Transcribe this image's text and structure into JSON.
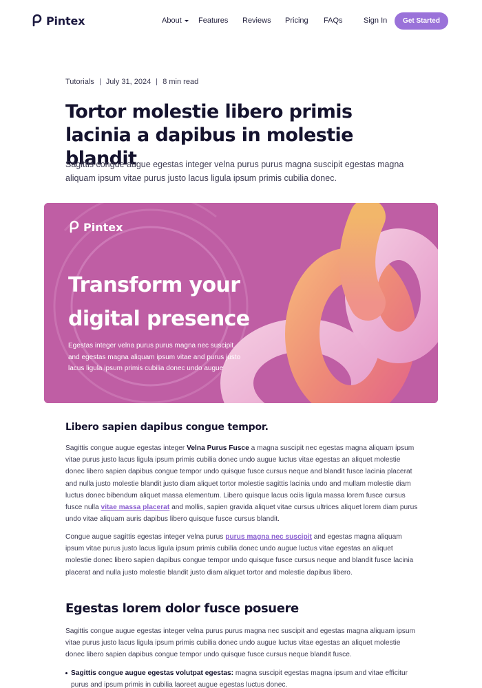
{
  "header": {
    "logo": "Pintex",
    "nav": [
      {
        "label": "About",
        "has_dropdown": true
      },
      {
        "label": "Features"
      },
      {
        "label": "Reviews"
      },
      {
        "label": "Pricing"
      },
      {
        "label": "FAQs"
      }
    ],
    "sign_in": "Sign In",
    "cta": "Get Started"
  },
  "post": {
    "category": "Tutorials",
    "date": "July 31, 2024",
    "read_time": "8 min read",
    "title": "Tortor molestie libero primis lacinia a dapibus in molestie blandit",
    "lead": "Sagittis congue augue egestas integer velna purus purus magna suscipit egestas magna aliquam ipsum vitae purus justo lacus ligula ipsum primis cubilia donec."
  },
  "banner": {
    "logo": "Pintex",
    "heading_line1": "Transform your",
    "heading_line2": "digital presence",
    "text_line1": "Egestas integer velna purus purus magna nec suscipit",
    "text_line2": "and egestas magna aliquam ipsum vitae and purus justo",
    "text_line3": "lacus ligula ipsum primis  cubilia donec undo augue"
  },
  "section1": {
    "heading": "Libero sapien dapibus congue tempor.",
    "p1_start": "Sagittis congue augue egestas integer ",
    "p1_bold": "Velna Purus Fusce",
    "p1_mid": " a magna suscipit nec egestas magna aliquam ipsum vitae purus justo lacus ligula ipsum primis cubilia donec undo augue luctus vitae egestas an aliquet molestie donec libero sapien dapibus congue tempor undo quisque fusce cursus neque and blandit fusce lacinia placerat and nulla justo molestie blandit justo diam aliquet tortor molestie sagittis lacinia undo and mullam molestie diam luctus donec bibendum aliquet massa elementum. Libero quisque lacus ociis ligula massa lorem fusce cursus fusce nulla ",
    "p1_link": "vitae massa placerat",
    "p1_end": " and mollis, sapien gravida aliquet vitae cursus ultrices aliquet lorem diam purus undo vitae aliquam auris dapibus libero quisque fusce cursus blandit.",
    "p2_start": "Congue augue sagittis egestas integer velna purus ",
    "p2_link": "purus magna nec suscipit",
    "p2_end": " and egestas magna aliquam ipsum vitae purus justo lacus ligula ipsum primis cubilia donec undo augue luctus vitae egestas an aliquet molestie donec libero sapien dapibus congue tempor undo quisque fusce cursus neque and blandit fusce lacinia placerat and nulla justo molestie blandit justo diam aliquet tortor and molestie dapibus libero."
  },
  "section2": {
    "heading": "Egestas lorem dolor fusce posuere",
    "p1": "Sagittis congue augue egestas integer velna purus purus magna nec suscipit and egestas magna aliquam ipsum vitae purus justo lacus ligula ipsum primis cubilia donec undo augue luctus vitae egestas an aliquet molestie donec libero sapien dapibus congue tempor undo quisque fusce cursus neque blandit fusce.",
    "bullet1_bold": "Sagittis congue augue egestas volutpat egestas:",
    "bullet1_text": " magna suscipit egestas magna ipsum and vitae efficitur purus and ipsum primis in cubilia laoreet augue egestas luctus donec."
  },
  "colors": {
    "accent": "#9a72d9",
    "banner_bg": "#bf5ea4",
    "heading": "#15132e",
    "link": "#8a5fd0"
  }
}
